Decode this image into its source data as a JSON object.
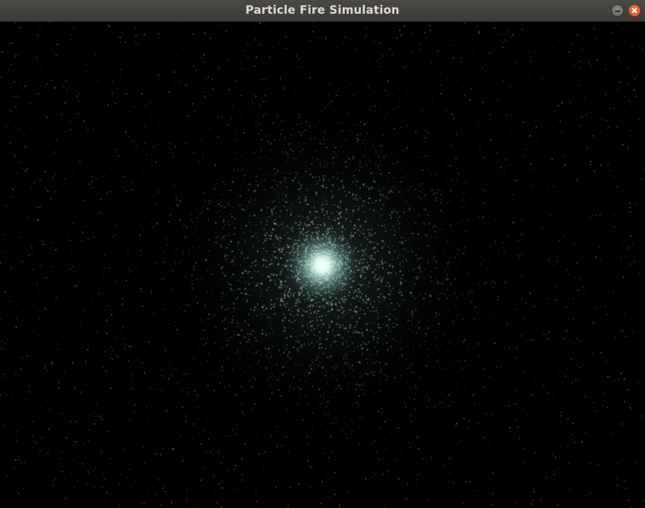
{
  "window": {
    "title": "Particle Fire Simulation",
    "minimize_icon": "minimize-icon",
    "close_icon": "close-icon"
  },
  "simulation": {
    "background_color": "#000000",
    "particle_color": "#a8cfc8",
    "core_color": "#e6fff6"
  }
}
